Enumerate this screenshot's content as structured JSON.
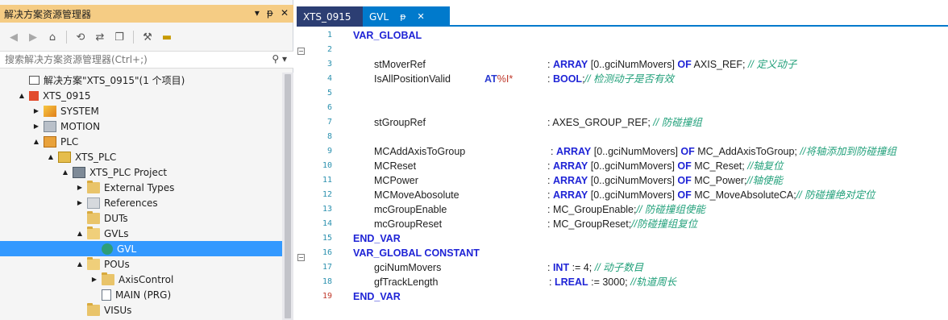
{
  "solution_explorer": {
    "title": "解决方案资源管理器",
    "title_actions": [
      "▾",
      "ᵽ",
      "✕"
    ],
    "search_placeholder": "搜索解决方案资源管理器(Ctrl+;)",
    "tree": [
      {
        "label": "解决方案\"XTS_0915\"(1 个项目)",
        "level": 0,
        "arrow": "",
        "icon": "solution-icon"
      },
      {
        "label": "XTS_0915",
        "level": 0,
        "arrow": "▲",
        "icon": "project-icon"
      },
      {
        "label": "SYSTEM",
        "level": 1,
        "arrow": "▶",
        "icon": "system-icon"
      },
      {
        "label": "MOTION",
        "level": 1,
        "arrow": "▶",
        "icon": "motion-icon"
      },
      {
        "label": "PLC",
        "level": 1,
        "arrow": "▲",
        "icon": "plc-icon"
      },
      {
        "label": "XTS_PLC",
        "level": 2,
        "arrow": "▲",
        "icon": "plc-subproject-icon"
      },
      {
        "label": "XTS_PLC Project",
        "level": 3,
        "arrow": "▲",
        "icon": "plc-project-icon"
      },
      {
        "label": "External Types",
        "level": 4,
        "arrow": "▶",
        "icon": "folder-icon"
      },
      {
        "label": "References",
        "level": 4,
        "arrow": "▶",
        "icon": "references-icon"
      },
      {
        "label": "DUTs",
        "level": 4,
        "arrow": "",
        "icon": "folder-icon"
      },
      {
        "label": "GVLs",
        "level": 4,
        "arrow": "▲",
        "icon": "folder-open-icon"
      },
      {
        "label": "GVL",
        "level": 5,
        "arrow": "",
        "icon": "gvl-icon",
        "selected": true
      },
      {
        "label": "POUs",
        "level": 4,
        "arrow": "▲",
        "icon": "folder-open-icon"
      },
      {
        "label": "AxisControl",
        "level": 5,
        "arrow": "▶",
        "icon": "folder-icon"
      },
      {
        "label": "MAIN (PRG)",
        "level": 5,
        "arrow": "",
        "icon": "prg-icon"
      },
      {
        "label": "VISUs",
        "level": 4,
        "arrow": "",
        "icon": "folder-icon"
      }
    ]
  },
  "editor": {
    "tabs": [
      {
        "label": "XTS_0915",
        "active": false
      },
      {
        "label": "GVL",
        "active": true,
        "pin": "ᵽ",
        "close": "✕"
      }
    ],
    "lines": [
      {
        "n": "1"
      },
      {
        "n": "2"
      },
      {
        "n": "3"
      },
      {
        "n": "4"
      },
      {
        "n": "5"
      },
      {
        "n": "6"
      },
      {
        "n": "7"
      },
      {
        "n": "8"
      },
      {
        "n": "9"
      },
      {
        "n": "10"
      },
      {
        "n": "11"
      },
      {
        "n": "12"
      },
      {
        "n": "13"
      },
      {
        "n": "14"
      },
      {
        "n": "15"
      },
      {
        "n": "16"
      },
      {
        "n": "17"
      },
      {
        "n": "18"
      },
      {
        "n": "19"
      }
    ],
    "code": {
      "l1_kw": "VAR_GLOBAL",
      "l3_var": "stMoverRef",
      "l3_type_a": ": ",
      "l3_kw1": "ARRAY",
      "l3_rng": " [0..gciNumMovers] ",
      "l3_kw2": "OF",
      "l3_type": " AXIS_REF; ",
      "l3_cmt": "// 定义动子",
      "l4_var": "IsAllPositionValid",
      "l4_at": "AT",
      "l4_addr": "%I*",
      "l4_colon": ": ",
      "l4_kw": "BOOL",
      "l4_semi": ";",
      "l4_cmt": "// 检测动子是否有效",
      "l7_var": "stGroupRef",
      "l7_type": ": AXES_GROUP_REF;",
      "l7_cmt": "  // 防碰撞组",
      "l9_var": "MCAddAxisToGroup",
      "l9_colon": ": ",
      "l9_kw1": "ARRAY",
      "l9_rng": " [0..gciNumMovers] ",
      "l9_kw2": "OF",
      "l9_type": " MC_AddAxisToGroup; ",
      "l9_cmt": "//将轴添加到防碰撞组",
      "l10_var": "MCReset",
      "l10_colon": ": ",
      "l10_kw1": "ARRAY",
      "l10_rng": " [0..gciNumMovers] ",
      "l10_kw2": "OF",
      "l10_type": " MC_Reset; ",
      "l10_cmt": "//轴复位",
      "l11_var": "MCPower",
      "l11_colon": ": ",
      "l11_kw1": "ARRAY",
      "l11_rng": " [0..gciNumMovers] ",
      "l11_kw2": "OF",
      "l11_type": " MC_Power;",
      "l11_cmt": "//轴使能",
      "l12_var": "MCMoveAbosolute",
      "l12_colon": ": ",
      "l12_kw1": "ARRAY",
      "l12_rng": " [0..gciNumMovers] ",
      "l12_kw2": "OF",
      "l12_type": " MC_MoveAbsoluteCA;",
      "l12_cmt": "// 防碰撞绝对定位",
      "l13_var": "mcGroupEnable",
      "l13_type": ": MC_GroupEnable;",
      "l13_cmt": "// 防碰撞组使能",
      "l14_var": "mcGroupReset",
      "l14_type": ": MC_GroupReset;",
      "l14_cmt": "//防碰撞组复位",
      "l15_kw": "END_VAR",
      "l16_kw": "VAR_GLOBAL CONSTANT",
      "l17_var": "gciNumMovers",
      "l17_colon": ": ",
      "l17_kw": "INT",
      "l17_val": " := 4; ",
      "l17_cmt": "// 动子数目",
      "l18_var": "gfTrackLength",
      "l18_colon": ": ",
      "l18_kw": "LREAL",
      "l18_val": " := 3000; ",
      "l18_cmt": "//轨道周长",
      "l19_kw": "END_VAR"
    }
  },
  "colors": {
    "accent": "#007acc",
    "selection": "#3399ff",
    "title_bar": "#f5cc84",
    "keyword": "#1f24d6",
    "comment": "#21a07a",
    "line_number": "#2b91af"
  }
}
